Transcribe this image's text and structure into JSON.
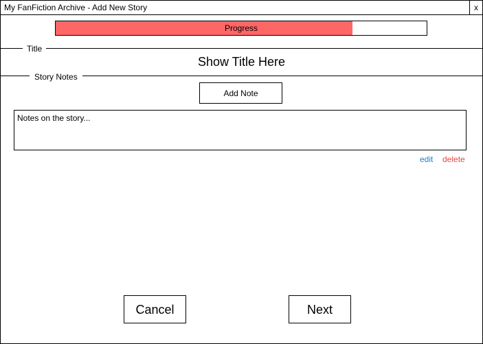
{
  "window": {
    "title": "My FanFiction Archive - Add New Story",
    "close_label": "x"
  },
  "progress": {
    "label": "Progress",
    "fraction": 0.8,
    "fill_color": "#ff6666"
  },
  "title_section": {
    "label": "Title",
    "value": "Show Title Here"
  },
  "notes_section": {
    "label": "Story Notes",
    "add_button": "Add Note",
    "note_text": "Notes on the story...",
    "edit_label": "edit",
    "delete_label": "delete"
  },
  "footer": {
    "cancel_label": "Cancel",
    "next_label": "Next"
  },
  "colors": {
    "edit_link": "#1a7fd4",
    "delete_link": "#ee4444"
  }
}
